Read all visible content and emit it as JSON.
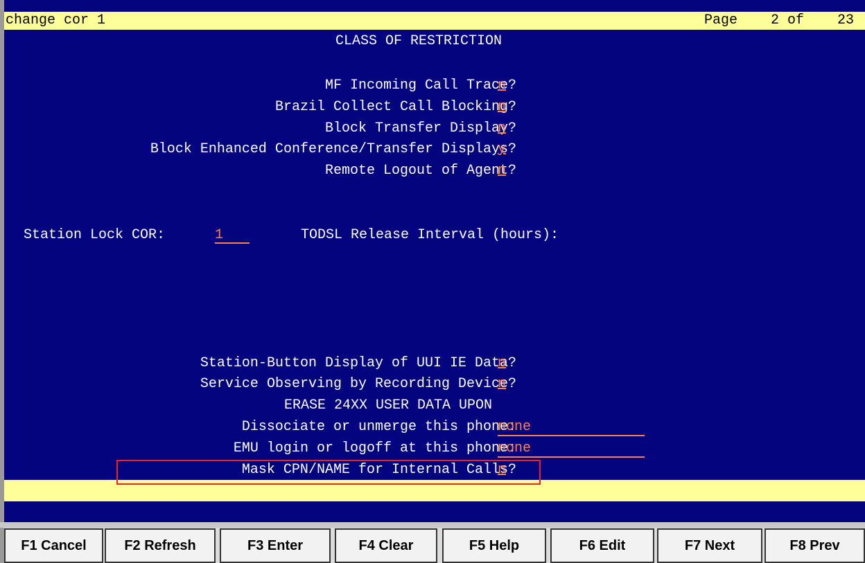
{
  "title_bar": {
    "command": "change cor 1",
    "page_label": "Page",
    "page_current": "2",
    "page_of": "of",
    "page_total": "23"
  },
  "form": {
    "heading": "CLASS OF RESTRICTION",
    "fields": {
      "mf_incoming_call_trace": {
        "label": "MF Incoming Call Trace?",
        "value": "n"
      },
      "brazil_collect_call_blocking": {
        "label": "Brazil Collect Call Blocking?",
        "value": "n"
      },
      "block_transfer_display": {
        "label": "Block Transfer Display?",
        "value": "n"
      },
      "block_enhanced_conf_transfer_displays": {
        "label": "Block Enhanced Conference/Transfer Displays?",
        "value": "y"
      },
      "remote_logout_of_agent": {
        "label": "Remote Logout of Agent?",
        "value": "n"
      },
      "station_lock_cor": {
        "label": "Station Lock COR:",
        "value": "1"
      },
      "todsl_release_interval": {
        "label": "TODSL Release Interval (hours):",
        "value": ""
      },
      "station_button_display_uui": {
        "label": "Station-Button Display of UUI IE Data?",
        "value": "n"
      },
      "service_observing_recording": {
        "label": "Service Observing by Recording Device?",
        "value": "n"
      },
      "erase_heading": "ERASE 24XX USER DATA UPON",
      "dissociate_unmerge": {
        "label": "Dissociate or unmerge this phone:",
        "value": "none"
      },
      "emu_login_logoff": {
        "label": "EMU login or logoff at this phone:",
        "value": "none"
      },
      "mask_cpn_name": {
        "label": "Mask CPN/NAME for Internal Calls?",
        "value": "n"
      }
    }
  },
  "message_bar": {
    "text": ""
  },
  "function_keys": [
    {
      "label": "F1 Cancel"
    },
    {
      "label": "F2 Refresh"
    },
    {
      "label": "F3 Enter"
    },
    {
      "label": "F4 Clear"
    },
    {
      "label": "F5 Help"
    },
    {
      "label": "F6 Edit"
    },
    {
      "label": "F7 Next"
    },
    {
      "label": "F8 Prev"
    }
  ],
  "colors": {
    "screen_bg": "#04047f",
    "bar_bg": "#ffff99",
    "field_value": "#ff7f50",
    "highlight_border": "#e22222"
  }
}
